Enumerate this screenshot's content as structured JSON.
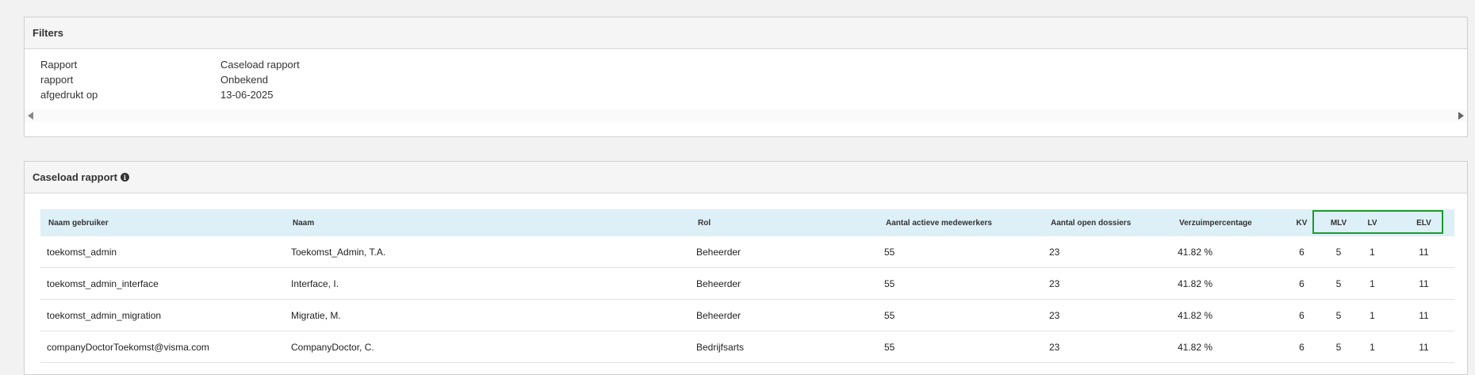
{
  "filters": {
    "title": "Filters",
    "rows": [
      {
        "label": "Rapport",
        "value": "Caseload rapport"
      },
      {
        "label": "rapport",
        "value": "Onbekend"
      },
      {
        "label": "afgedrukt op",
        "value": "13-06-2025"
      }
    ]
  },
  "caseload": {
    "title": "Caseload rapport",
    "info_icon": "info-circle-icon",
    "columns": [
      "Naam gebruiker",
      "Naam",
      "Rol",
      "Aantal actieve medewerkers",
      "Aantal open dossiers",
      "Verzuimpercentage",
      "KV",
      "MLV",
      "LV",
      "ELV"
    ],
    "rows": [
      [
        "toekomst_admin",
        "Toekomst_Admin, T.A.",
        "Beheerder",
        "55",
        "23",
        "41.82 %",
        "6",
        "5",
        "1",
        "11"
      ],
      [
        "toekomst_admin_interface",
        "Interface, I.",
        "Beheerder",
        "55",
        "23",
        "41.82 %",
        "6",
        "5",
        "1",
        "11"
      ],
      [
        "toekomst_admin_migration",
        "Migratie, M.",
        "Beheerder",
        "55",
        "23",
        "41.82 %",
        "6",
        "5",
        "1",
        "11"
      ],
      [
        "companyDoctorToekomst@visma.com",
        "CompanyDoctor, C.",
        "Bedrijfsarts",
        "55",
        "23",
        "41.82 %",
        "6",
        "5",
        "1",
        "11"
      ]
    ]
  },
  "colors": {
    "header_bg": "#ddeff7",
    "highlight": "#1e9a2e"
  }
}
